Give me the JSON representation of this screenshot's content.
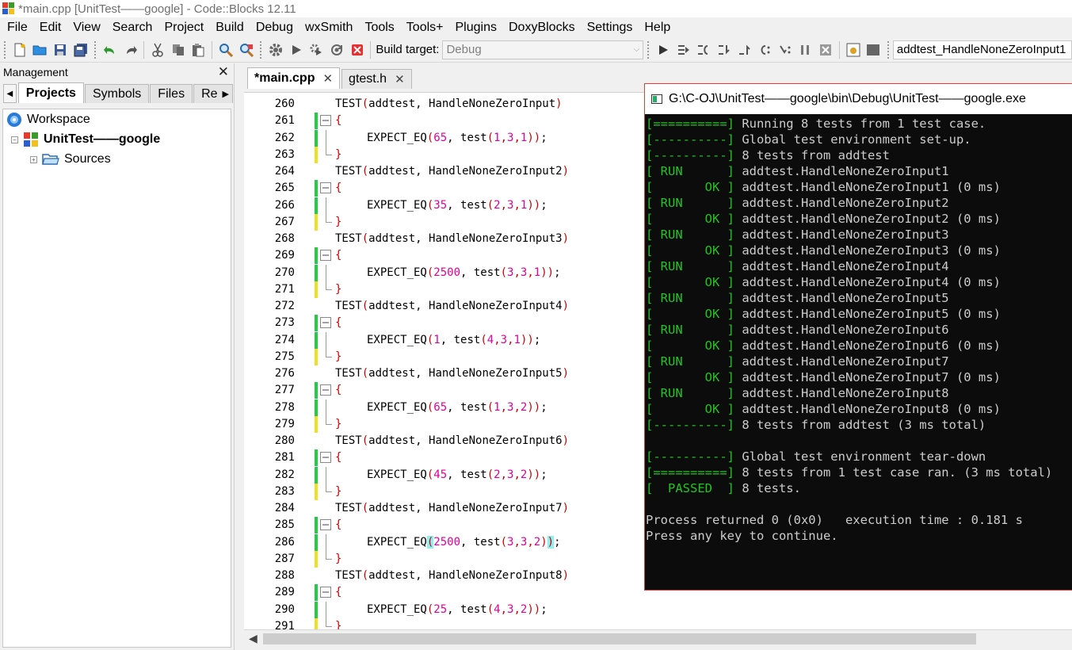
{
  "window": {
    "title": "*main.cpp [UnitTest——google] - Code::Blocks 12.11"
  },
  "menu": [
    "File",
    "Edit",
    "View",
    "Search",
    "Project",
    "Build",
    "Debug",
    "wxSmith",
    "Tools",
    "Tools+",
    "Plugins",
    "DoxyBlocks",
    "Settings",
    "Help"
  ],
  "toolbar": {
    "build_target_label": "Build target:",
    "build_target_value": "Debug",
    "function_select": "addtest_HandleNoneZeroInput1"
  },
  "management": {
    "title": "Management",
    "tabs": [
      "Projects",
      "Symbols",
      "Files",
      "Re"
    ],
    "active_tab": "Projects",
    "tree": {
      "workspace": "Workspace",
      "project": "UnitTest——google",
      "sources": "Sources"
    }
  },
  "editor": {
    "tabs": [
      {
        "label": "*main.cpp",
        "active": true
      },
      {
        "label": "gtest.h",
        "active": false
      }
    ],
    "lines": [
      {
        "n": "260",
        "kind": "test",
        "name": "HandleNoneZeroInput"
      },
      {
        "n": "261",
        "kind": "open"
      },
      {
        "n": "262",
        "kind": "expect",
        "exp": "65",
        "args": "1,3,1"
      },
      {
        "n": "263",
        "kind": "close"
      },
      {
        "n": "264",
        "kind": "test",
        "name": "HandleNoneZeroInput2"
      },
      {
        "n": "265",
        "kind": "open"
      },
      {
        "n": "266",
        "kind": "expect",
        "exp": "35",
        "args": "2,3,1"
      },
      {
        "n": "267",
        "kind": "close"
      },
      {
        "n": "268",
        "kind": "test",
        "name": "HandleNoneZeroInput3"
      },
      {
        "n": "269",
        "kind": "open"
      },
      {
        "n": "270",
        "kind": "expect",
        "exp": "2500",
        "args": "3,3,1"
      },
      {
        "n": "271",
        "kind": "close"
      },
      {
        "n": "272",
        "kind": "test",
        "name": "HandleNoneZeroInput4"
      },
      {
        "n": "273",
        "kind": "open"
      },
      {
        "n": "274",
        "kind": "expect",
        "exp": "1",
        "args": "4,3,1"
      },
      {
        "n": "275",
        "kind": "close"
      },
      {
        "n": "276",
        "kind": "test",
        "name": "HandleNoneZeroInput5"
      },
      {
        "n": "277",
        "kind": "open"
      },
      {
        "n": "278",
        "kind": "expect",
        "exp": "65",
        "args": "1,3,2"
      },
      {
        "n": "279",
        "kind": "close"
      },
      {
        "n": "280",
        "kind": "test",
        "name": "HandleNoneZeroInput6"
      },
      {
        "n": "281",
        "kind": "open"
      },
      {
        "n": "282",
        "kind": "expect",
        "exp": "45",
        "args": "2,3,2"
      },
      {
        "n": "283",
        "kind": "close"
      },
      {
        "n": "284",
        "kind": "test",
        "name": "HandleNoneZeroInput7"
      },
      {
        "n": "285",
        "kind": "open"
      },
      {
        "n": "286",
        "kind": "expect",
        "exp": "2500",
        "args": "3,3,2",
        "highlight": true
      },
      {
        "n": "287",
        "kind": "close"
      },
      {
        "n": "288",
        "kind": "test",
        "name": "HandleNoneZeroInput8"
      },
      {
        "n": "289",
        "kind": "open"
      },
      {
        "n": "290",
        "kind": "expect",
        "exp": "25",
        "args": "4,3,2"
      },
      {
        "n": "291",
        "kind": "close"
      }
    ]
  },
  "console": {
    "title": "G:\\C-OJ\\UnitTest——google\\bin\\Debug\\UnitTest——google.exe",
    "lines": [
      {
        "tag": "[==========]",
        "text": " Running 8 tests from 1 test case."
      },
      {
        "tag": "[----------]",
        "text": " Global test environment set-up."
      },
      {
        "tag": "[----------]",
        "text": " 8 tests from addtest"
      },
      {
        "tag": "[ RUN      ]",
        "text": " addtest.HandleNoneZeroInput1"
      },
      {
        "tag": "[       OK ]",
        "text": " addtest.HandleNoneZeroInput1 (0 ms)"
      },
      {
        "tag": "[ RUN      ]",
        "text": " addtest.HandleNoneZeroInput2"
      },
      {
        "tag": "[       OK ]",
        "text": " addtest.HandleNoneZeroInput2 (0 ms)"
      },
      {
        "tag": "[ RUN      ]",
        "text": " addtest.HandleNoneZeroInput3"
      },
      {
        "tag": "[       OK ]",
        "text": " addtest.HandleNoneZeroInput3 (0 ms)"
      },
      {
        "tag": "[ RUN      ]",
        "text": " addtest.HandleNoneZeroInput4"
      },
      {
        "tag": "[       OK ]",
        "text": " addtest.HandleNoneZeroInput4 (0 ms)"
      },
      {
        "tag": "[ RUN      ]",
        "text": " addtest.HandleNoneZeroInput5"
      },
      {
        "tag": "[       OK ]",
        "text": " addtest.HandleNoneZeroInput5 (0 ms)"
      },
      {
        "tag": "[ RUN      ]",
        "text": " addtest.HandleNoneZeroInput6"
      },
      {
        "tag": "[       OK ]",
        "text": " addtest.HandleNoneZeroInput6 (0 ms)"
      },
      {
        "tag": "[ RUN      ]",
        "text": " addtest.HandleNoneZeroInput7"
      },
      {
        "tag": "[       OK ]",
        "text": " addtest.HandleNoneZeroInput7 (0 ms)"
      },
      {
        "tag": "[ RUN      ]",
        "text": " addtest.HandleNoneZeroInput8"
      },
      {
        "tag": "[       OK ]",
        "text": " addtest.HandleNoneZeroInput8 (0 ms)"
      },
      {
        "tag": "[----------]",
        "text": " 8 tests from addtest (3 ms total)"
      },
      {
        "tag": "",
        "text": ""
      },
      {
        "tag": "[----------]",
        "text": " Global test environment tear-down"
      },
      {
        "tag": "[==========]",
        "text": " 8 tests from 1 test case ran. (3 ms total)"
      },
      {
        "tag": "[  PASSED  ]",
        "text": " 8 tests."
      },
      {
        "tag": "",
        "text": ""
      },
      {
        "tag": "",
        "text": "Process returned 0 (0x0)   execution time : 0.181 s"
      },
      {
        "tag": "",
        "text": "Press any key to continue."
      }
    ]
  },
  "colors": {
    "console_green": "#22c422",
    "number_magenta": "#e0009a",
    "paren_red": "#d00000",
    "match_highlight": "#8ff0f0",
    "change_green": "#22cc44",
    "change_yellow": "#f0e020",
    "console_border": "#e83a3a"
  }
}
